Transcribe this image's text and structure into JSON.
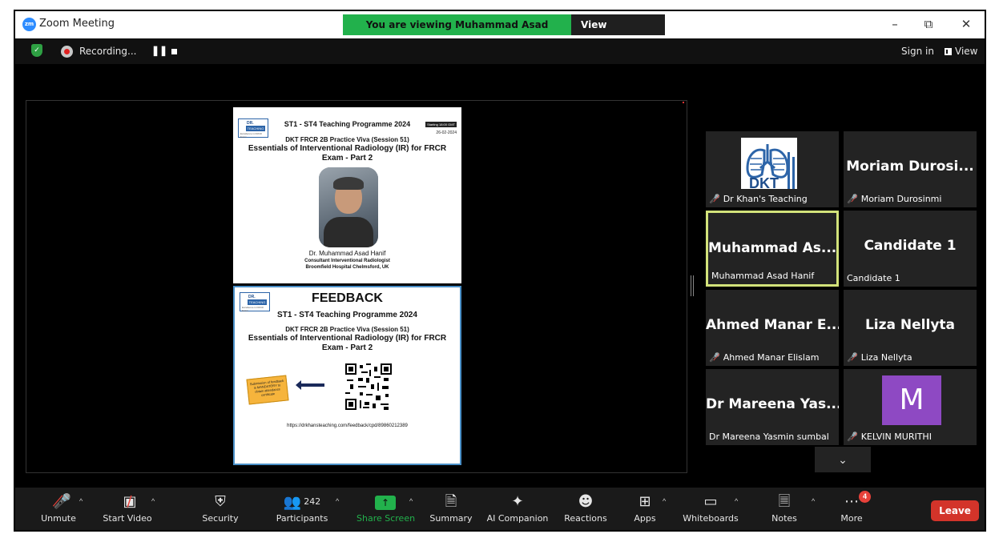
{
  "window": {
    "title": "Zoom Meeting",
    "viewing_banner": "You are viewing Muhammad Asad Hanif's screen",
    "view_options": "View Options"
  },
  "top_toolbar": {
    "recording": "Recording...",
    "sign_in": "Sign in",
    "view": "View"
  },
  "slide1": {
    "logo_top": "DR. KHAN'S",
    "logo_band": "TEACHING",
    "logo_sub": "Excellence in FRCR Exam",
    "badge": "Starting 18:00 GMT",
    "date": "26-02-2024",
    "programme": "ST1 - ST4 Teaching Programme 2024",
    "subtitle": "DKT FRCR 2B Practice Viva (Session 51)",
    "main": "Essentials of Interventional Radiology (IR) for FRCR Exam - Part 2",
    "presenter_name": "Dr. Muhammad Asad Hanif",
    "presenter_role": "Consultant Interventional Radiologist",
    "presenter_hospital": "Broomfield Hospital Chelmsford, UK"
  },
  "slide2": {
    "logo_top": "DR. KHAN'S",
    "logo_band": "TEACHING",
    "logo_sub": "Excellence in FRCR Exam",
    "heading": "FEEDBACK",
    "programme": "ST1 - ST4 Teaching Programme 2024",
    "subtitle": "DKT FRCR 2B Practice Viva (Session 51)",
    "main": "Essentials of Interventional Radiology (IR) for FRCR Exam - Part 2",
    "sticky_note": "Submission of feedback is MANDATORY to obtain attendance certificate",
    "url": "https://drkhansteaching.com/feedback/cpd/89860212389"
  },
  "participants_tiles": [
    {
      "display": "",
      "name": "Dr Khan's Teaching",
      "muted": true,
      "overlay": "DKT"
    },
    {
      "display": "Moriam Durosi...",
      "name": "Moriam Durosinmi",
      "muted": true
    },
    {
      "display": "Muhammad As...",
      "name": "Muhammad Asad Hanif",
      "muted": false
    },
    {
      "display": "Candidate 1",
      "name": "Candidate 1",
      "muted": false
    },
    {
      "display": "Ahmed Manar E...",
      "name": "Ahmed Manar Elislam",
      "muted": true
    },
    {
      "display": "Liza Nellyta",
      "name": "Liza Nellyta",
      "muted": true
    },
    {
      "display": "Dr Mareena Yas...",
      "name": "Dr Mareena Yasmin sumbal",
      "muted": false
    },
    {
      "display": "M",
      "name": "KELVIN MURITHI",
      "muted": true
    }
  ],
  "bottom_toolbar": {
    "unmute": "Unmute",
    "start_video": "Start Video",
    "security": "Security",
    "participants": "Participants",
    "participants_count": "242",
    "share_screen": "Share Screen",
    "summary": "Summary",
    "ai_companion": "AI Companion",
    "reactions": "Reactions",
    "apps": "Apps",
    "whiteboards": "Whiteboards",
    "notes": "Notes",
    "more": "More",
    "more_badge": "4",
    "leave": "Leave"
  },
  "colors": {
    "zoom_blue": "#2d8cff",
    "share_green": "#22b14c",
    "leave_red": "#d3342a",
    "active_speaker_border": "#d2e27a",
    "avatar_purple": "#8e49c3"
  }
}
